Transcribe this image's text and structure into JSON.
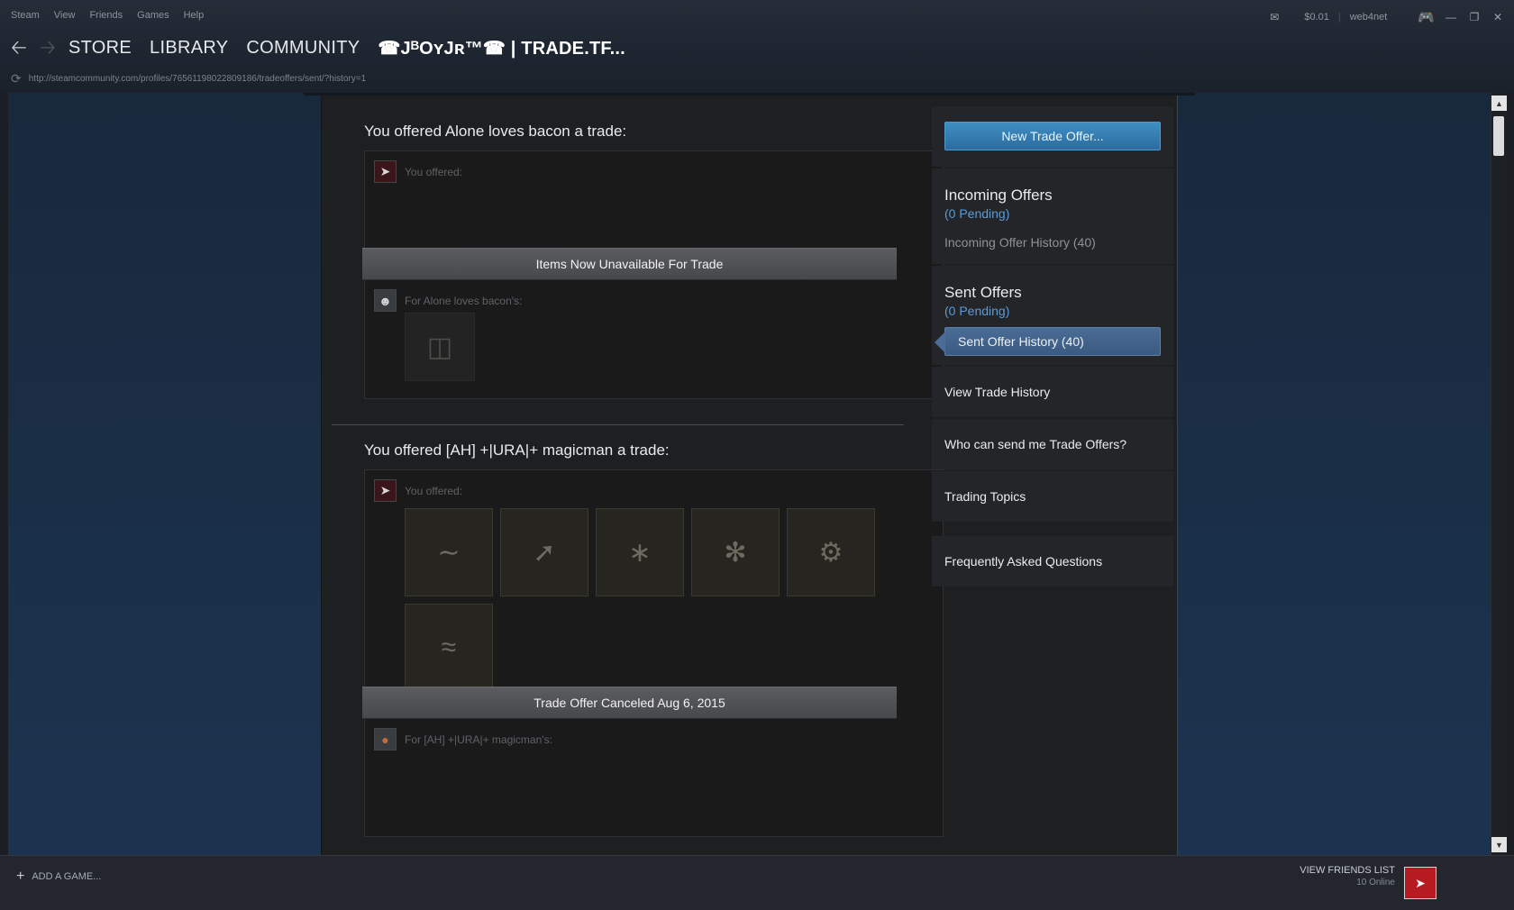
{
  "menubar": {
    "items": [
      "Steam",
      "View",
      "Friends",
      "Games",
      "Help"
    ]
  },
  "topright": {
    "wallet": "$0.01",
    "username": "web4net"
  },
  "nav": {
    "store": "STORE",
    "library": "LIBRARY",
    "community": "COMMUNITY",
    "page_title": "☎JᴮOʏJʀ™☎ | TRADE.TF..."
  },
  "url": "http://steamcommunity.com/profiles/76561198022809186/tradeoffers/sent/?history=1",
  "offers": [
    {
      "title": "You offered Alone loves bacon a trade:",
      "you_offered_label": "You offered:",
      "status_banner": "Items Now Unavailable For Trade",
      "for_label": "For Alone loves bacon's:"
    },
    {
      "title": "You offered [AH] +|URA|+ magicman a trade:",
      "you_offered_label": "You offered:",
      "status_banner": "Trade Offer Canceled Aug 6, 2015",
      "for_label": "For [AH] +|URA|+ magicman's:"
    }
  ],
  "sidebar": {
    "new_offer_button": "New Trade Offer...",
    "incoming_heading": "Incoming Offers",
    "incoming_pending": "(0 Pending)",
    "incoming_history": "Incoming Offer History (40)",
    "sent_heading": "Sent Offers",
    "sent_pending": "(0 Pending)",
    "sent_history": "Sent Offer History (40)",
    "view_trade_history": "View Trade History",
    "who_can_send": "Who can send me Trade Offers?",
    "trading_topics": "Trading Topics",
    "faq": "Frequently Asked Questions"
  },
  "bottombar": {
    "add_game": "ADD A GAME...",
    "view_friends": "VIEW FRIENDS LIST",
    "online": "10 Online"
  },
  "colors": {
    "accent_blue": "#3f8ec3",
    "pending_blue": "#5a9bd9",
    "active_item": "#4a6c96",
    "page_bg": "#1c3149"
  }
}
